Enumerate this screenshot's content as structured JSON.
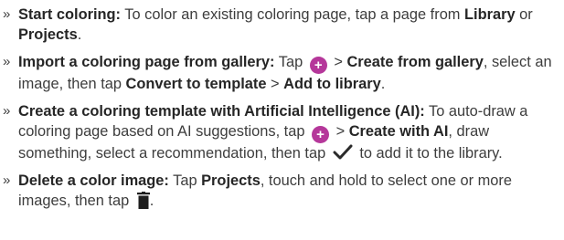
{
  "bullet_glyph": "»",
  "plus_glyph": "+",
  "accent_color": "#b5379a",
  "items": [
    {
      "title": "Start coloring:",
      "t1": " To color an existing coloring page, tap a page from ",
      "b1": "Library",
      "t2": " or ",
      "b2": "Projects",
      "t3": "."
    },
    {
      "title": "Import a coloring page from gallery:",
      "t1": " Tap ",
      "t2": " > ",
      "b1": "Create from gallery",
      "t3": ", select an image, then tap  ",
      "b2": "Convert to template",
      "t4": " > ",
      "b3": "Add to library",
      "t5": "."
    },
    {
      "title": "Create a coloring template with Artificial Intelligence (AI):",
      "t1": " To auto-draw a coloring page based on AI suggestions, tap ",
      "t2": " > ",
      "b1": "Create with AI",
      "t3": ", draw something, select a recommendation, then tap ",
      "t4": " to add it to the library."
    },
    {
      "title": "Delete a color image:",
      "t1": " Tap ",
      "b1": "Projects",
      "t2": ", touch and hold to select one or more images, then tap ",
      "t3": "."
    }
  ]
}
